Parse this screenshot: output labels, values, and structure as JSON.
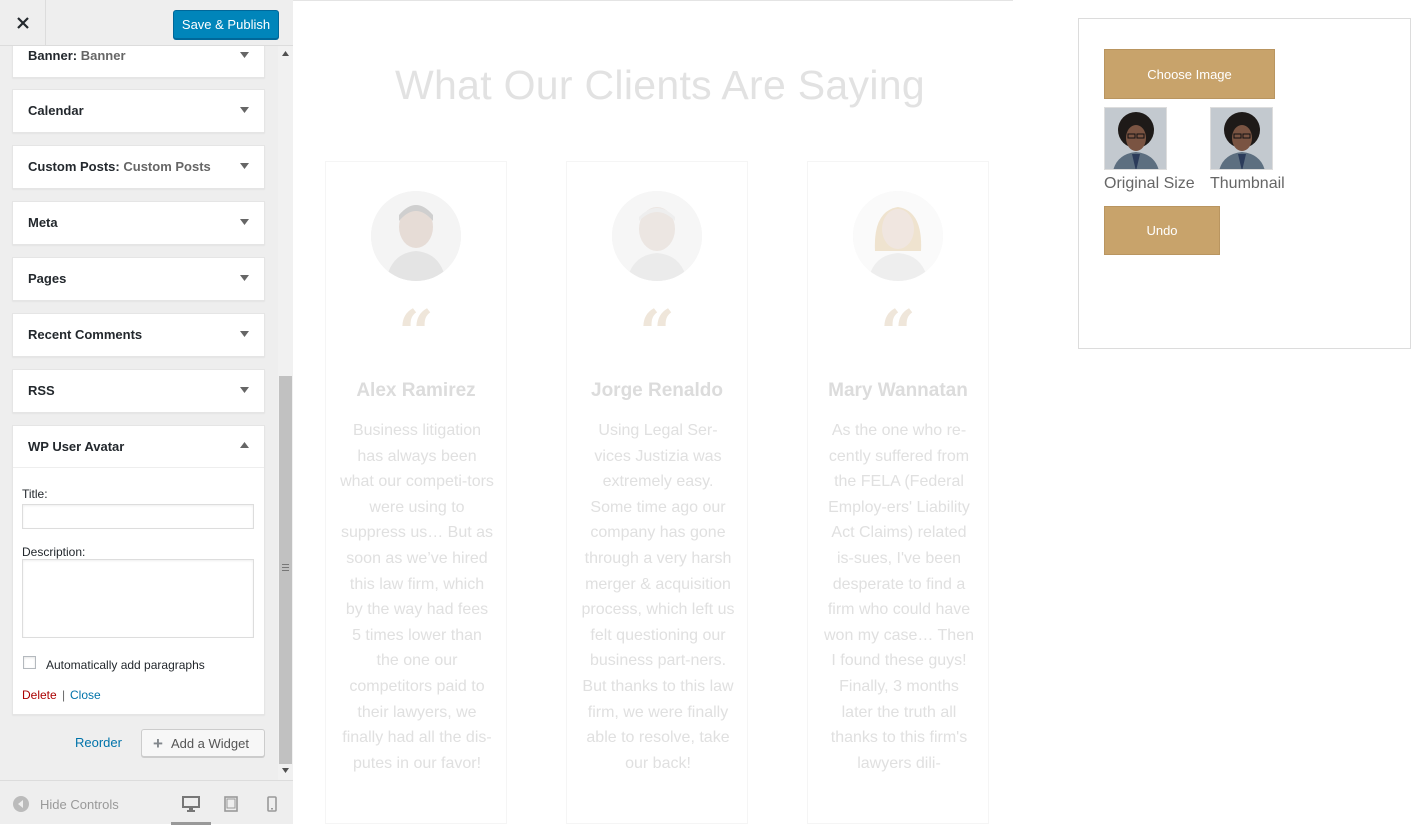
{
  "header": {
    "close_icon": "close-icon",
    "save_label": "Save & Publish"
  },
  "widgets": [
    {
      "name": "Banner",
      "sub": "Banner"
    },
    {
      "name": "Calendar",
      "sub": ""
    },
    {
      "name": "Custom Posts",
      "sub": "Custom Posts"
    },
    {
      "name": "Meta",
      "sub": ""
    },
    {
      "name": "Pages",
      "sub": ""
    },
    {
      "name": "Recent Comments",
      "sub": ""
    },
    {
      "name": "RSS",
      "sub": ""
    }
  ],
  "open_widget": {
    "name": "WP User Avatar",
    "title_label": "Title:",
    "title_value": "",
    "description_label": "Description:",
    "description_value": "",
    "autop_label": "Automatically add paragraphs",
    "autop_checked": false,
    "delete_label": "Delete",
    "separator": "|",
    "close_label": "Close"
  },
  "actions": {
    "reorder_label": "Reorder",
    "add_widget_label": "Add a Widget"
  },
  "footer": {
    "hide_controls_label": "Hide Controls",
    "devices": [
      "desktop-icon",
      "tablet-icon",
      "mobile-icon"
    ],
    "active_device": "desktop"
  },
  "preview": {
    "section_title": "What Our Clients Are Saying",
    "testimonials": [
      {
        "name": "Alex Ramirez",
        "text": "Business litigation has always been what our competi-tors were using to suppress us… But as soon as we’ve hired this law firm, which by the way had fees 5 times lower than the one our competitors paid to their lawyers, we finally had all the dis-putes  in our favor!"
      },
      {
        "name": "Jorge Renaldo",
        "text": "Using Legal Ser-vices Justizia was extremely easy. Some time ago our company has gone through a very harsh merger & acquisition process, which left us felt questioning our business part-ners. But thanks to this law firm, we were finally able to resolve, take our back!"
      },
      {
        "name": "Mary Wannatan",
        "text": "As the one who re-cently suffered from the FELA (Federal Employ-ers' Liability Act Claims) related is-sues, I've been desperate to find a firm who could have won my case… Then I found these guys! Finally, 3 months later the truth all thanks to this firm's lawyers dili-"
      }
    ],
    "avatar_widget": {
      "choose_label": "Choose Image",
      "original_label": "Original Size",
      "thumbnail_label": "Thumbnail",
      "undo_label": "Undo"
    }
  },
  "colors": {
    "primary_button": "#0085ba",
    "link": "#0073aa",
    "delete": "#aa0000",
    "gold_button": "#c8a36b"
  }
}
